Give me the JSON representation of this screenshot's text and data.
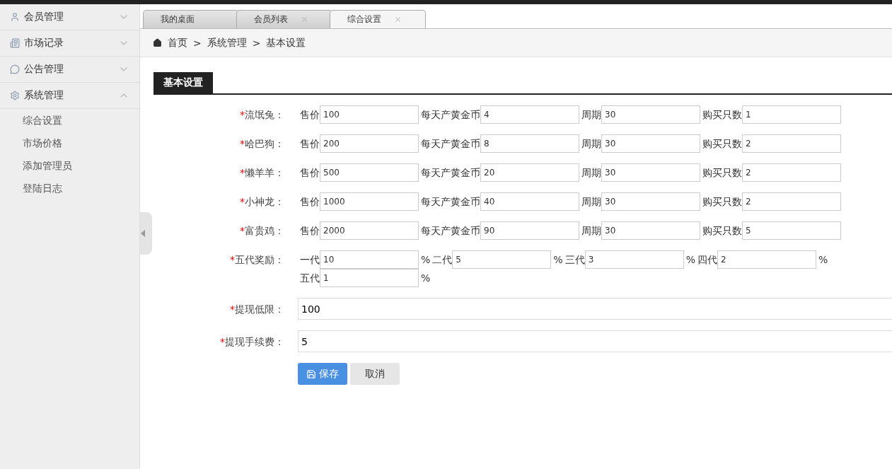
{
  "sidebar": {
    "items": [
      {
        "label": "会员管理",
        "expanded": false
      },
      {
        "label": "市场记录",
        "expanded": false
      },
      {
        "label": "公告管理",
        "expanded": false
      },
      {
        "label": "系统管理",
        "expanded": true,
        "children": [
          {
            "label": "综合设置"
          },
          {
            "label": "市场价格"
          },
          {
            "label": "添加管理员"
          },
          {
            "label": "登陆日志"
          }
        ]
      }
    ]
  },
  "tabs": [
    {
      "label": "我的桌面",
      "selected": false,
      "closable": false
    },
    {
      "label": "会员列表",
      "selected": false,
      "closable": true
    },
    {
      "label": "综合设置",
      "selected": true,
      "closable": true
    }
  ],
  "breadcrumb": {
    "items": [
      "首页",
      "系统管理",
      "基本设置"
    ],
    "separator": ">"
  },
  "section_title": "基本设置",
  "form": {
    "required_mark": "*",
    "pets": [
      {
        "label": "流氓兔：",
        "fields": [
          {
            "label": "售价",
            "value": "100"
          },
          {
            "label": "每天产黄金币",
            "value": "4"
          },
          {
            "label": "周期",
            "value": "30"
          },
          {
            "label": "购买只数",
            "value": "1"
          }
        ]
      },
      {
        "label": "哈巴狗：",
        "fields": [
          {
            "label": "售价",
            "value": "200"
          },
          {
            "label": "每天产黄金币",
            "value": "8"
          },
          {
            "label": "周期",
            "value": "30"
          },
          {
            "label": "购买只数",
            "value": "2"
          }
        ]
      },
      {
        "label": "懒羊羊：",
        "fields": [
          {
            "label": "售价",
            "value": "500"
          },
          {
            "label": "每天产黄金币",
            "value": "20"
          },
          {
            "label": "周期",
            "value": "30"
          },
          {
            "label": "购买只数",
            "value": "2"
          }
        ]
      },
      {
        "label": "小神龙：",
        "fields": [
          {
            "label": "售价",
            "value": "1000"
          },
          {
            "label": "每天产黄金币",
            "value": "40"
          },
          {
            "label": "周期",
            "value": "30"
          },
          {
            "label": "购买只数",
            "value": "2"
          }
        ]
      },
      {
        "label": "富贵鸡：",
        "fields": [
          {
            "label": "售价",
            "value": "2000"
          },
          {
            "label": "每天产黄金币",
            "value": "90"
          },
          {
            "label": "周期",
            "value": "30"
          },
          {
            "label": "购买只数",
            "value": "5"
          }
        ]
      }
    ],
    "rewards": {
      "label": "五代奖励：",
      "levels": [
        {
          "label": "一代",
          "value": "10",
          "unit": "%"
        },
        {
          "label": "二代",
          "value": "5",
          "unit": "%"
        },
        {
          "label": "三代",
          "value": "3",
          "unit": "%"
        },
        {
          "label": "四代",
          "value": "2",
          "unit": "%"
        },
        {
          "label": "五代",
          "value": "1",
          "unit": "%"
        }
      ]
    },
    "settings": [
      {
        "label": "提现低限：",
        "value": "100"
      },
      {
        "label": "提现手续费：",
        "value": "5"
      }
    ],
    "buttons": [
      {
        "label": "保存",
        "kind": "primary"
      },
      {
        "label": "取消",
        "kind": "secondary"
      }
    ]
  }
}
